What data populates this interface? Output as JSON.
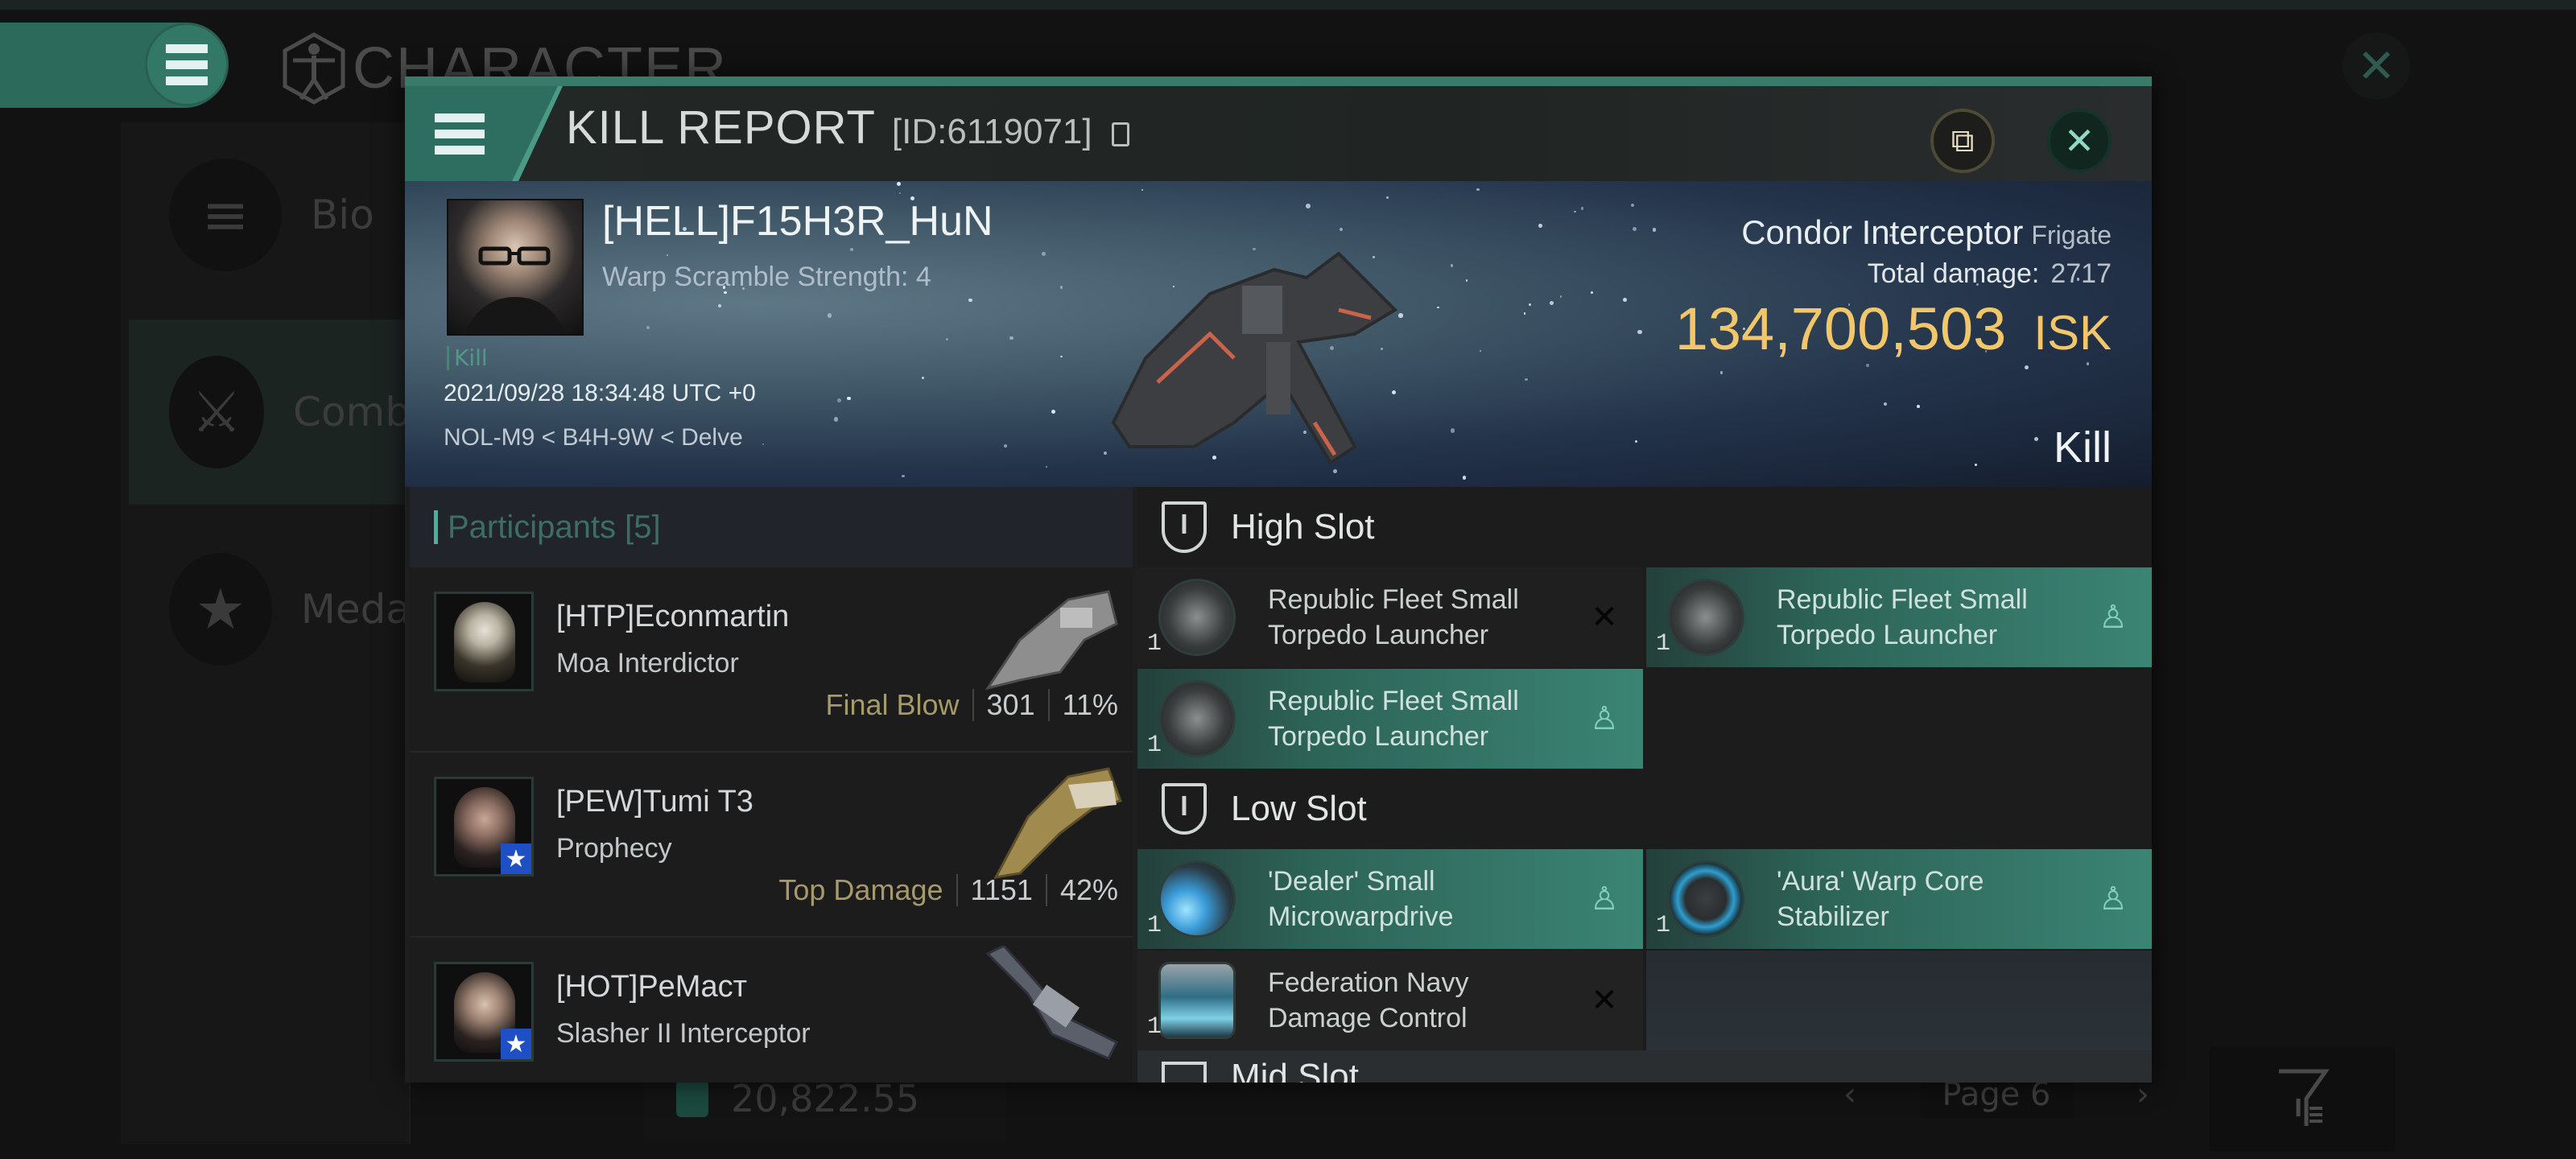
{
  "background": {
    "screen_title": "CHARACTER",
    "sidebar": [
      {
        "label": "Bio",
        "icon": "list-icon"
      },
      {
        "label": "Comb",
        "icon": "crossed-swords-icon",
        "active": true
      },
      {
        "label": "Meda",
        "icon": "star-badge-icon"
      }
    ],
    "wallet_value": "20,822.55",
    "page_label": "Page 6",
    "prev_glyph": "‹",
    "next_glyph": "›",
    "close_glyph": "✕",
    "filter_glyph": "⏷"
  },
  "modal": {
    "title": "KILL REPORT",
    "report_id": "[ID:6119071]",
    "share_glyph": "⧉",
    "close_glyph": "✕",
    "victim": {
      "name": "[HELL]F15H3R_HuN",
      "warp_scramble": "Warp Scramble Strength: 4",
      "kill_tag": "Kill",
      "timestamp": "2021/09/28 18:34:48 UTC +0",
      "location": "NOL-M9 < B4H-9W < Delve",
      "ship_name": "Condor Interceptor",
      "ship_class": "Frigate",
      "total_damage_label": "Total damage:",
      "total_damage": "2717",
      "isk_value": "134,700,503",
      "isk_unit": "ISK",
      "result": "Kill"
    },
    "participants": {
      "title": "Participants [5]",
      "count": 5,
      "rows": [
        {
          "name": "[HTP]Econmartin",
          "ship": "Moa Interdictor",
          "tag": "Final Blow",
          "damage": "301",
          "percent": "11%",
          "badge": false
        },
        {
          "name": "[PEW]Tumi T3",
          "ship": "Prophecy",
          "tag": "Top Damage",
          "damage": "1151",
          "percent": "42%",
          "badge": true,
          "badge_glyph": "★"
        },
        {
          "name": "[HOT]PeMacт",
          "ship": "Slasher II Interceptor",
          "tag": "",
          "damage": "",
          "percent": "",
          "badge": true,
          "badge_glyph": "★"
        }
      ]
    },
    "slots": {
      "high": {
        "title": "High Slot",
        "modules": [
          {
            "qty": "1",
            "name": "Republic Fleet Small Torpedo Launcher",
            "state": "destroyed",
            "state_glyph": "✕"
          },
          {
            "qty": "1",
            "name": "Republic Fleet Small Torpedo Launcher",
            "state": "dropped",
            "state_glyph": "♙"
          },
          {
            "qty": "1",
            "name": "Republic Fleet Small Torpedo Launcher",
            "state": "dropped",
            "state_glyph": "♙"
          }
        ]
      },
      "low": {
        "title": "Low Slot",
        "modules": [
          {
            "qty": "1",
            "name": "'Dealer' Small Microwarpdrive",
            "state": "dropped",
            "state_glyph": "♙"
          },
          {
            "qty": "1",
            "name": "'Aura' Warp Core Stabilizer",
            "state": "dropped",
            "state_glyph": "♙"
          },
          {
            "qty": "1",
            "name": "Federation Navy Damage Control",
            "state": "destroyed",
            "state_glyph": "✕"
          }
        ]
      },
      "mid": {
        "title": "Mid Slot"
      }
    }
  },
  "colors": {
    "accent": "#2e6e60",
    "isk": "#f2c76a",
    "tag": "#a6996a",
    "fitted": "#3b8473"
  }
}
